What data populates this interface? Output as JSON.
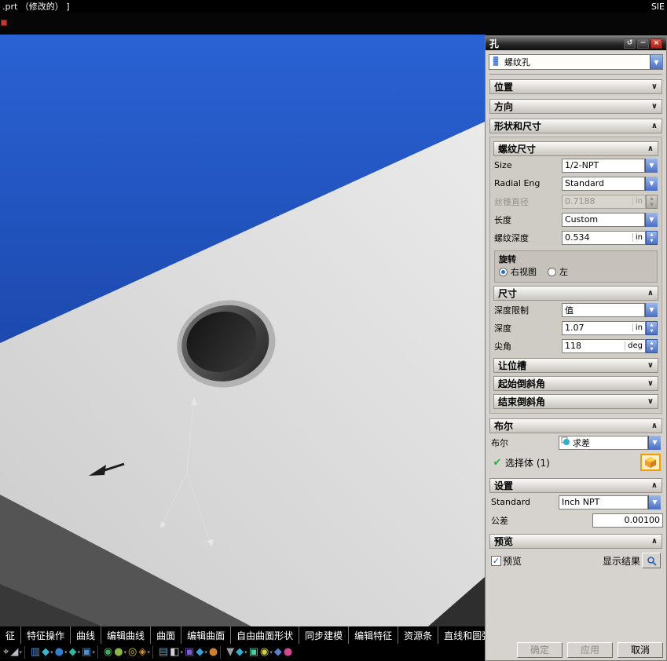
{
  "window": {
    "title": ".prt （修改的） ]",
    "brand": "SIE"
  },
  "dialog": {
    "title": "孔",
    "type_value": "螺纹孔",
    "sections": {
      "position": "位置",
      "direction": "方向",
      "shape": "形状和尺寸",
      "thread": {
        "header": "螺纹尺寸",
        "size_label": "Size",
        "size_value": "1/2-NPT",
        "radial_label": "Radial Eng",
        "radial_value": "Standard",
        "tap_label": "丝锥直径",
        "tap_value": "0.7188",
        "tap_unit": "in",
        "length_label": "长度",
        "length_value": "Custom",
        "tdepth_label": "螺纹深度",
        "tdepth_value": "0.534",
        "tdepth_unit": "in",
        "rotation_label": "旋转",
        "rotation_right": "右视图",
        "rotation_left": "左"
      },
      "dims": {
        "header": "尺寸",
        "limit_label": "深度限制",
        "limit_value": "值",
        "depth_label": "深度",
        "depth_value": "1.07",
        "depth_unit": "in",
        "tip_label": "尖角",
        "tip_value": "118",
        "tip_unit": "deg"
      },
      "relief": "让位槽",
      "start_chamfer": "起始倒斜角",
      "end_chamfer": "结束倒斜角",
      "boolean": {
        "header": "布尔",
        "label": "布尔",
        "value": "求差",
        "select_label": "选择体 (1)"
      },
      "settings": {
        "header": "设置",
        "standard_label": "Standard",
        "standard_value": "Inch NPT",
        "tol_label": "公差",
        "tol_value": "0.00100"
      },
      "preview": {
        "header": "预览",
        "checkbox_label": "预览",
        "show_label": "显示结果"
      }
    },
    "buttons": {
      "ok": "确定",
      "apply": "应用",
      "cancel": "取消"
    }
  },
  "tabs": [
    "征",
    "特征操作",
    "曲线",
    "编辑曲线",
    "曲面",
    "编辑曲面",
    "自由曲面形状",
    "同步建模",
    "编辑特征",
    "资源条",
    "直线和圆弧"
  ],
  "bottom_icons": [
    {
      "g": "⌖",
      "c": "#cfd3d8"
    },
    {
      "g": "◢",
      "c": "#b8bec6",
      "a": true
    },
    {
      "sep": true
    },
    {
      "g": "▥",
      "c": "#5b93d8"
    },
    {
      "g": "◆",
      "c": "#3fb3c9",
      "a": true
    },
    {
      "g": "●",
      "c": "#2f7fd0",
      "a": true
    },
    {
      "g": "◆",
      "c": "#36b5a0",
      "a": true
    },
    {
      "g": "▣",
      "c": "#4a8fd4",
      "a": true
    },
    {
      "sep": true
    },
    {
      "g": "◉",
      "c": "#3fae5a"
    },
    {
      "g": "●",
      "c": "#8ab64a",
      "a": true
    },
    {
      "g": "◎",
      "c": "#d0c23f"
    },
    {
      "g": "◈",
      "c": "#d08f2f",
      "a": true
    },
    {
      "sep": true
    },
    {
      "g": "▤",
      "c": "#4a9fd4"
    },
    {
      "g": "◧",
      "c": "#cfd4da",
      "a": true
    },
    {
      "g": "▣",
      "c": "#7f5bd0"
    },
    {
      "g": "◆",
      "c": "#3f9fd0",
      "a": true
    },
    {
      "g": "●",
      "c": "#d07f2f"
    },
    {
      "sep": true
    },
    {
      "g": "▼",
      "c": "#9aa0a8"
    },
    {
      "g": "◆",
      "c": "#2fb0d0",
      "a": true
    },
    {
      "g": "▣",
      "c": "#4ad0a0"
    },
    {
      "g": "◉",
      "c": "#d0d04a",
      "a": true
    },
    {
      "g": "◆",
      "c": "#5b7fd0"
    },
    {
      "g": "●",
      "c": "#d04a8f"
    }
  ]
}
